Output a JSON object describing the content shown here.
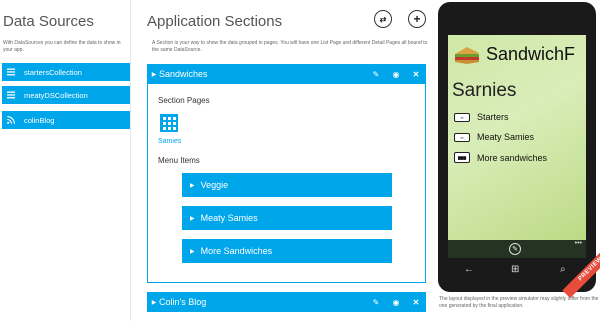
{
  "data_sources": {
    "title": "Data Sources",
    "description": "With DataSources you can define the data to show in your app.",
    "items": [
      {
        "label": "startersCollection",
        "icon": "list-icon"
      },
      {
        "label": "meatyDSCollection",
        "icon": "list-icon"
      },
      {
        "label": "colinBlog",
        "icon": "rss-icon"
      }
    ]
  },
  "app_sections": {
    "title": "Application Sections",
    "header_buttons": [
      "⇄",
      "+"
    ],
    "description": "A Section is your way to show the data grouped in pages. You will have one List Page and different Detail Pages all bound to the same DataSource.",
    "sections": [
      {
        "title": "Sandwiches",
        "expanded": true
      },
      {
        "title": "Colin's Blog",
        "expanded": false
      }
    ],
    "section_pages_label": "Section Pages",
    "page_tile_label": "Samies",
    "menu_items_label": "Menu Items",
    "menu_items": [
      "Veggie",
      "Meaty Samies",
      "More Sandwiches"
    ]
  },
  "phone_preview": {
    "app_title": "SandwichF",
    "subtitle": "Sarnies",
    "items": [
      {
        "label": "Starters",
        "icon": "sandwich-icon"
      },
      {
        "label": "Meaty Samies",
        "icon": "sandwich-icon"
      },
      {
        "label": "More sandwiches",
        "icon": "bbc-food-icon"
      }
    ],
    "preview_label": "PREVIEW",
    "note": "The layout displayed in the preview simulator may slightly differ from the one generated by the final application."
  },
  "colors": {
    "accent": "#00a6ea",
    "preview_ribbon": "#e74c3c"
  }
}
